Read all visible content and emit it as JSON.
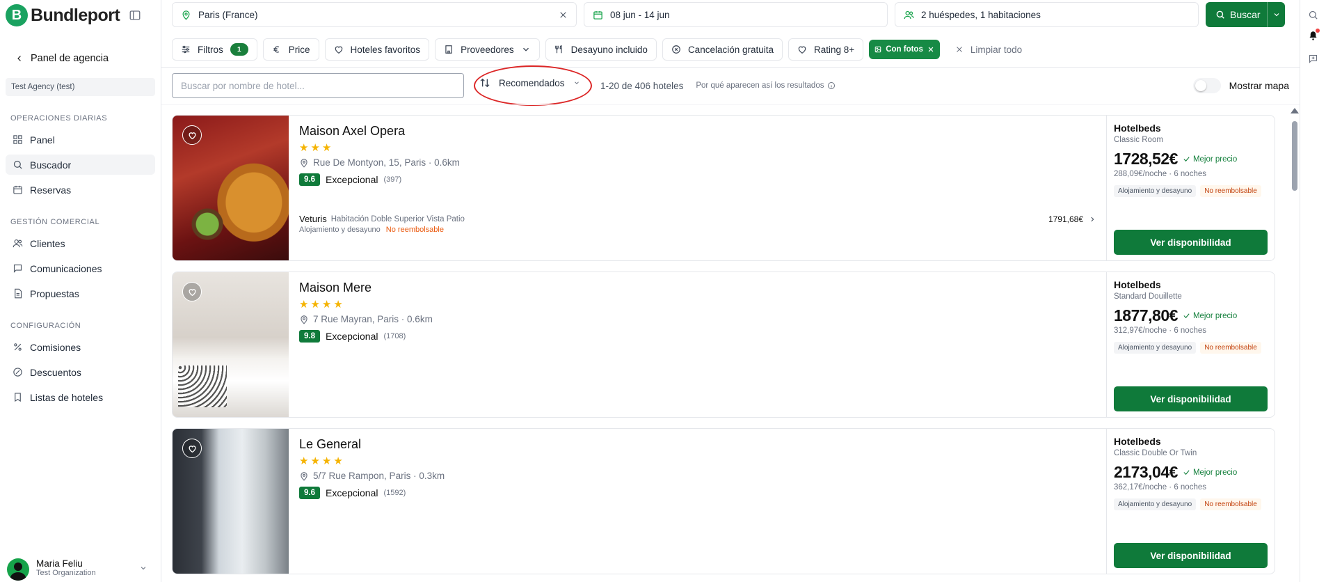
{
  "app": {
    "brand": "Bundleport",
    "logo_letter": "B"
  },
  "sidebar": {
    "back_label": "Panel de agencia",
    "agency": "Test Agency (test)",
    "sections": [
      {
        "title": "OPERACIONES DIARIAS",
        "items": [
          {
            "label": "Panel",
            "icon": "dashboard-icon"
          },
          {
            "label": "Buscador",
            "icon": "search-icon",
            "active": true
          },
          {
            "label": "Reservas",
            "icon": "calendar-icon"
          }
        ]
      },
      {
        "title": "GESTIÓN COMERCIAL",
        "items": [
          {
            "label": "Clientes",
            "icon": "users-icon"
          },
          {
            "label": "Comunicaciones",
            "icon": "chat-icon"
          },
          {
            "label": "Propuestas",
            "icon": "document-icon"
          }
        ]
      },
      {
        "title": "CONFIGURACIÓN",
        "items": [
          {
            "label": "Comisiones",
            "icon": "percent-icon"
          },
          {
            "label": "Descuentos",
            "icon": "discount-icon"
          },
          {
            "label": "Listas de hoteles",
            "icon": "bookmark-icon"
          }
        ]
      }
    ],
    "user": {
      "name": "Maria Feliu",
      "org": "Test Organization"
    }
  },
  "search": {
    "destination": "Paris (France)",
    "dates": "08 jun - 14 jun",
    "guests": "2 huéspedes, 1 habitaciones",
    "button": "Buscar"
  },
  "filters": {
    "filtros_label": "Filtros",
    "filtros_count": "1",
    "chips": [
      "Price",
      "Hoteles favoritos",
      "Proveedores",
      "Desayuno incluido",
      "Cancelación gratuita",
      "Rating 8+"
    ],
    "active_chip": "Con fotos",
    "clear_all": "Limpiar todo"
  },
  "toolbar": {
    "hotel_search_placeholder": "Buscar por nombre de hotel...",
    "sort_label": "Recomendados",
    "results_count": "1-20 de 406 hoteles",
    "why_results": "Por qué aparecen así los resultados",
    "map_label": "Mostrar mapa"
  },
  "hotels": [
    {
      "name": "Maison Axel Opera",
      "stars": "★★★",
      "address": "Rue De Montyon, 15, Paris · 0.6km",
      "score": "9.6",
      "rating_label": "Excepcional",
      "reviews": "(397)",
      "alt_offer": {
        "provider": "Veturis",
        "room": "Habitación Doble Superior Vista Patio",
        "meal": "Alojamiento y desayuno",
        "policy": "No reembolsable",
        "price": "1791,68€"
      },
      "provider": "Hotelbeds",
      "room": "Classic Room",
      "price": "1728,52€",
      "best_price": "Mejor precio",
      "per_night": "288,09€/noche · 6 noches",
      "meal_tag": "Alojamiento y desayuno",
      "policy_tag": "No reembolsable",
      "cta": "Ver disponibilidad"
    },
    {
      "name": "Maison Mere",
      "stars": "★★★★",
      "address": "7 Rue Mayran, Paris · 0.6km",
      "score": "9.8",
      "rating_label": "Excepcional",
      "reviews": "(1708)",
      "provider": "Hotelbeds",
      "room": "Standard Douillette",
      "price": "1877,80€",
      "best_price": "Mejor precio",
      "per_night": "312,97€/noche · 6 noches",
      "meal_tag": "Alojamiento y desayuno",
      "policy_tag": "No reembolsable",
      "cta": "Ver disponibilidad"
    },
    {
      "name": "Le General",
      "stars": "★★★★",
      "address": "5/7 Rue Rampon, Paris · 0.3km",
      "score": "9.6",
      "rating_label": "Excepcional",
      "reviews": "(1592)",
      "provider": "Hotelbeds",
      "room": "Classic Double Or Twin",
      "price": "2173,04€",
      "best_price": "Mejor precio",
      "per_night": "362,17€/noche · 6 noches",
      "meal_tag": "Alojamiento y desayuno",
      "policy_tag": "No reembolsable",
      "cta": "Ver disponibilidad"
    }
  ],
  "colors": {
    "brand_green": "#0f7a3a",
    "highlight_red": "#dc2626",
    "star": "#f5b301",
    "warning": "#ea580c"
  }
}
